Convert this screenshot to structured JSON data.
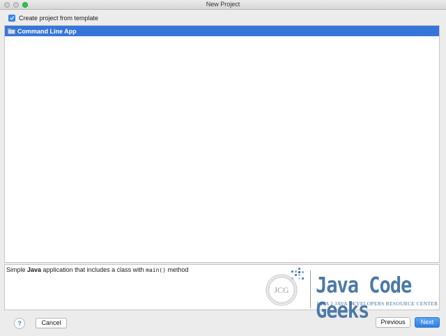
{
  "window": {
    "title": "New Project"
  },
  "template_option": {
    "label": "Create project from template",
    "checked": true
  },
  "templates": [
    {
      "label": "Command Line App",
      "selected": true
    }
  ],
  "description": {
    "prefix": "Simple ",
    "language": "Java",
    "middle": " application that includes a class with ",
    "code": "main()",
    "suffix": " method"
  },
  "logo": {
    "mark": "JCG",
    "name": "Java Code Geeks",
    "tagline": "JAVA 2 JAVA DEVELOPERS RESOURCE CENTER"
  },
  "footer": {
    "help_label": "?",
    "cancel_label": "Cancel",
    "previous_label": "Previous",
    "next_label": "Next"
  },
  "colors": {
    "selection": "#3776d8",
    "primary_button": "#2f7fe4",
    "logo_blue": "#4c79a8"
  }
}
